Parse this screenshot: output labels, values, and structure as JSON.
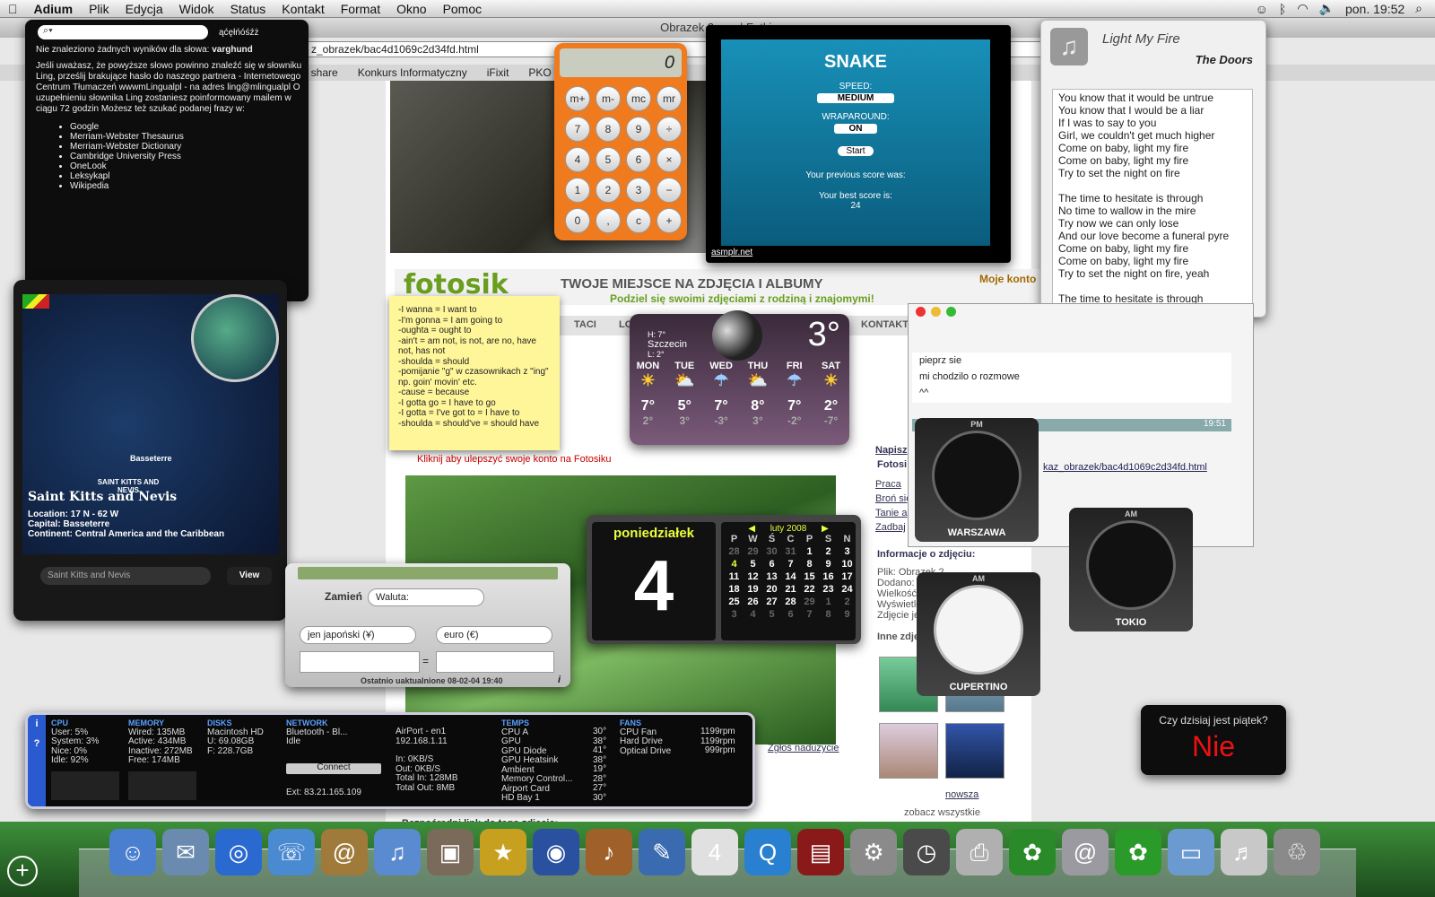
{
  "menubar": {
    "app": "Adium",
    "items": [
      "Plik",
      "Edycja",
      "Widok",
      "Status",
      "Kontakt",
      "Format",
      "Okno",
      "Pomoc"
    ],
    "clock": "pon. 19:52"
  },
  "browser": {
    "title": "Obrazek 2.png | Fotki,",
    "url": "z_obrazek/bac4d1069c2d34fd.html",
    "bookmarks": [
      "t share",
      "Konkurs Informatyczny",
      "iFixit",
      "PKO Ba"
    ],
    "fotosik_logo": "fotosik",
    "fotosik_tagline": "TWOJE MIEJSCE NA ZDJĘCIA I ALBUMY",
    "fotosik_sub": "Podziel się swoimi zdjęciami z rodziną i znajomymi!",
    "moje_konto": "Moje konto",
    "nav": [
      "TACI",
      "LOSUJ",
      "KONTAKT"
    ],
    "upgrade": "Kliknij aby ulepszyć swoje konto na Fotosiku",
    "report": "Zgłoś nadużycie",
    "sidebar": [
      "Napisz",
      "Fotosi",
      "Praca ",
      "Broń się",
      "Tanie a",
      "Zadbaj ",
      "Informacje o zdjęciu:",
      "Plik: Obrazek 2",
      "Dodano:",
      "Wielkość:",
      "Wyświetleń",
      "Zdjęcie jes",
      "Inne zdję"
    ],
    "next": "nowsza",
    "see_all": "zobacz wszystkie",
    "bottom": "Bezpośredni link do tego zdjęcia:"
  },
  "dictionary": {
    "letters": "ąćęłńóśźż",
    "notfound": "Nie znaleziono żadnych wyników dla słowa:",
    "word": "varghund",
    "message": "Jeśli uważasz, że powyższe słowo powinno znaleźć się w słowniku Ling, prześlij brakujące hasło do naszego partnera - Internetowego Centrum Tłumaczeń wwwmLingualpl - na adres ling@mlingualpl O uzupełnieniu słownika Ling zostaniesz poinformowany mailem w ciągu 72 godzin Możesz też szukać podanej frazy w:",
    "sources": [
      "Google",
      "Merriam-Webster Thesaurus",
      "Merriam-Webster Dictionary",
      "Cambridge University Press",
      "OneLook",
      "Leksykapl",
      "Wikipedia"
    ]
  },
  "world": {
    "capital_label": "Basseterre",
    "map_label": "SAINT KITTS AND NEVIS",
    "name": "Saint Kitts and Nevis",
    "location": "Location: 17 N - 62 W",
    "capital": "Capital: Basseterre",
    "continent": "Continent: Central America and the Caribbean",
    "field": "Saint Kitts and Nevis",
    "view": "View"
  },
  "calculator": {
    "display": "0",
    "keys": [
      "m+",
      "m-",
      "mc",
      "mr",
      "7",
      "8",
      "9",
      "÷",
      "4",
      "5",
      "6",
      "×",
      "1",
      "2",
      "3",
      "−",
      "0",
      ",",
      "c",
      "+"
    ]
  },
  "snake": {
    "title": "SNAKE",
    "speed_label": "SPEED:",
    "speed": "MEDIUM",
    "wrap_label": "WRAPAROUND:",
    "wrap": "ON",
    "start": "Start",
    "prev": "Your previous score was:",
    "best": "Your best score is:",
    "best_val": "24",
    "credit": "asmplr.net"
  },
  "lyrics": {
    "song": "Light My Fire",
    "artist": "The Doors",
    "text": "You know that it would be untrue\nYou know that I would be a liar\nIf I was to say to you\nGirl, we couldn't get much higher\nCome on baby, light my fire\nCome on baby, light my fire\nTry to set the night on fire\n\nThe time to hesitate is through\nNo time to wallow in the mire\nTry now we can only lose\nAnd our love become a funeral pyre\nCome on baby, light my fire\nCome on baby, light my fire\nTry to set the night on fire, yeah\n\nThe time to hesitate is through"
  },
  "sticky": {
    "lines": [
      "-I wanna = I want to",
      "-I'm gonna = I am going to",
      "-oughta = ought to",
      "-ain't = am not, is not, are no, have not, has not",
      "-shoulda = should",
      "-pomijanie \"g\" w czasownikach z \"ing\" np. goin' movin' etc.",
      "-cause = because",
      "-I gotta go = I have to go",
      "-I gotta = I've got to = I have to",
      "-shoulda = should've = should have"
    ]
  },
  "weather": {
    "hi": "H: 7°",
    "city": "Szczecin",
    "lo": "L: 2°",
    "temp": "3°",
    "days": [
      {
        "d": "MON",
        "h": "7°",
        "l": "2°",
        "i": "☀"
      },
      {
        "d": "TUE",
        "h": "5°",
        "l": "3°",
        "i": "⛅"
      },
      {
        "d": "WED",
        "h": "7°",
        "l": "-3°",
        "i": "☂"
      },
      {
        "d": "THU",
        "h": "8°",
        "l": "3°",
        "i": "⛅"
      },
      {
        "d": "FRI",
        "h": "7°",
        "l": "-2°",
        "i": "☂"
      },
      {
        "d": "SAT",
        "h": "2°",
        "l": "-7°",
        "i": "☀"
      }
    ]
  },
  "currency": {
    "label": "Zamień",
    "type": "Waluta:",
    "from": "jen japoński (¥)",
    "to": "euro (€)",
    "eq": "=",
    "updated": "Ostatnio uaktualnione 08-02-04 19:40"
  },
  "calendar": {
    "dayname": "poniedziałek",
    "day": "4",
    "month": "luty 2008",
    "headers": [
      "P",
      "W",
      "Ś",
      "C",
      "P",
      "S",
      "N"
    ],
    "cells": [
      "28",
      "29",
      "30",
      "31",
      "1",
      "2",
      "3",
      "4",
      "5",
      "6",
      "7",
      "8",
      "9",
      "10",
      "11",
      "12",
      "13",
      "14",
      "15",
      "16",
      "17",
      "18",
      "19",
      "20",
      "21",
      "22",
      "23",
      "24",
      "25",
      "26",
      "27",
      "28",
      "29",
      "1",
      "2",
      "3",
      "4",
      "5",
      "6",
      "7",
      "8",
      "9"
    ]
  },
  "clocks": [
    {
      "city": "WARSZAWA",
      "ampm": "PM"
    },
    {
      "city": "TOKIO",
      "ampm": "AM"
    },
    {
      "city": "CUPERTINO",
      "ampm": "AM"
    }
  ],
  "chat": {
    "lines": [
      "pieprz sie",
      "mi chodzilo o rozmowe",
      "^^"
    ],
    "time": "19:51",
    "link": "kaz_obrazek/bac4d1069c2d34fd.html"
  },
  "istat": {
    "cpu": {
      "h": "CPU",
      "rows": [
        "User: 5%",
        "System: 3%",
        "Nice: 0%",
        "Idle: 92%"
      ]
    },
    "memory": {
      "h": "MEMORY",
      "rows": [
        "Wired: 135MB",
        "Active: 434MB",
        "Inactive: 272MB",
        "Free: 174MB"
      ]
    },
    "disks": {
      "h": "DISKS",
      "rows": [
        "Macintosh HD",
        "U: 69.08GB",
        "F: 228.7GB"
      ]
    },
    "bluetooth": {
      "h": "NETWORK",
      "rows": [
        "Bluetooth - Bl...",
        "Idle"
      ],
      "button": "Connect",
      "ext": "Ext: 83.21.165.109"
    },
    "network": {
      "rows": [
        "AirPort - en1",
        "192.168.1.11",
        "",
        "In: 0KB/S",
        "Out: 0KB/S",
        "Total In: 128MB",
        "Total Out: 8MB"
      ]
    },
    "temps": {
      "h": "TEMPS",
      "rows": [
        "CPU A",
        "GPU",
        "GPU Diode",
        "GPU Heatsink",
        "Ambient",
        "Memory Control...",
        "Airport Card",
        "HD Bay 1"
      ],
      "vals": [
        "30°",
        "38°",
        "41°",
        "38°",
        "19°",
        "28°",
        "27°",
        "30°"
      ]
    },
    "fans": {
      "h": "FANS",
      "rows": [
        "CPU Fan",
        "Hard Drive",
        "Optical Drive"
      ],
      "vals": [
        "1199rpm",
        "1199rpm",
        "999rpm"
      ]
    }
  },
  "friday": {
    "q": "Czy dzisiaj jest piątek?",
    "a": "Nie"
  },
  "dock": {
    "icons": [
      "finder-icon",
      "mail-icon",
      "safari-icon",
      "ichat-icon",
      "addressbook-icon",
      "itunes-icon",
      "iphoto-icon",
      "imovie-icon",
      "idvd-icon",
      "garageband-icon",
      "iweb-icon",
      "ical-icon",
      "quicktime-icon",
      "photobooth-icon",
      "syspref-icon",
      "timemachine-icon",
      "printer-icon",
      "adium-icon",
      "mail-at-icon",
      "frog-icon",
      "folder-icon",
      "dgg-icon",
      "trash-icon"
    ],
    "glyphs": [
      "☺",
      "✉",
      "◎",
      "☏",
      "@",
      "♫",
      "▣",
      "★",
      "◉",
      "♪",
      "✎",
      "4",
      "Q",
      "▤",
      "⚙",
      "◷",
      "⎙",
      "✿",
      "@",
      "✿",
      "▭",
      "♬",
      "♲"
    ],
    "colors": [
      "#4a7fd0",
      "#6a8ab0",
      "#2a6ad0",
      "#4a8ad0",
      "#a07a3a",
      "#5a8ad0",
      "#7a6a5a",
      "#c8a020",
      "#2a50a0",
      "#a0602a",
      "#3a6ab0",
      "#e0e0e0",
      "#2a80d0",
      "#8a1a1a",
      "#8a8a8a",
      "#4a4a4a",
      "#b0b0b0",
      "#2a8a2a",
      "#9a9aa0",
      "#2a9a2a",
      "#6a9ad0",
      "#c8c8c8",
      "#8a8a8a"
    ]
  }
}
